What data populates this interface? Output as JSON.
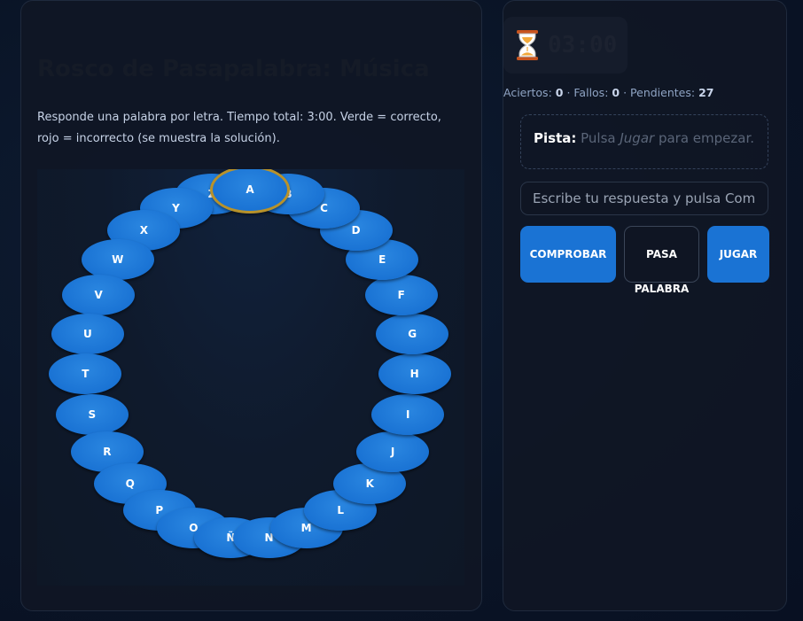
{
  "header": {
    "title": "Rosco de Pasapalabra: Música",
    "description": "Responde una palabra por letra. Tiempo total: 3:00. Verde = correcto, rojo = incorrecto (se muestra la solución)."
  },
  "rosco": {
    "letters": [
      "A",
      "B",
      "C",
      "D",
      "E",
      "F",
      "G",
      "H",
      "I",
      "J",
      "K",
      "L",
      "M",
      "N",
      "Ñ",
      "O",
      "P",
      "Q",
      "R",
      "S",
      "T",
      "U",
      "V",
      "W",
      "X",
      "Y",
      "Z"
    ],
    "active": "A",
    "status": "pending",
    "color": "#1a73d4",
    "active_ring_color": "#b8922a"
  },
  "timer": {
    "icon": "hourglass-icon",
    "value": "03:00"
  },
  "stats": {
    "hits_label": "Aciertos:",
    "hits": "0",
    "sep1": " · ",
    "misses_label": "Fallos:",
    "misses": "0",
    "sep2": " · ",
    "pending_label": "Pendientes:",
    "pending": "27"
  },
  "clue": {
    "label": "Pista:",
    "text_before": "Pulsa ",
    "text_em": "Jugar",
    "text_after": " para empezar."
  },
  "answer": {
    "placeholder": "Escribe tu respuesta y pulsa Comprobar",
    "value": ""
  },
  "buttons": {
    "check": "COMPROBAR",
    "pass_line1": "PASA",
    "pass_line2": "PALABRA",
    "play": "JUGAR"
  }
}
